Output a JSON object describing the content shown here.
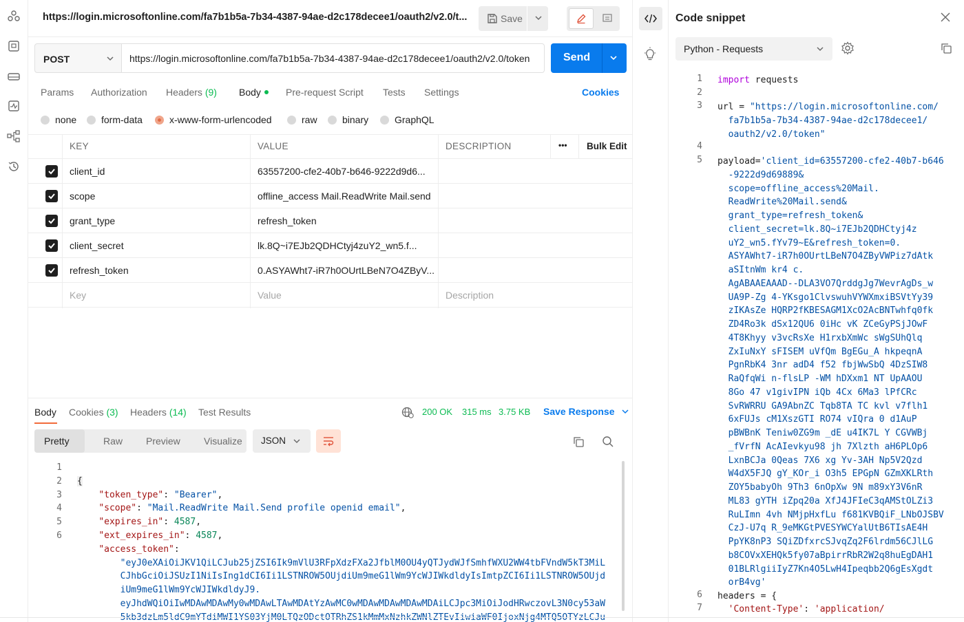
{
  "request": {
    "title": "https://login.microsoftonline.com/fa7b1b5a-7b34-4387-94ae-d2c178decee1/oauth2/v2.0/t...",
    "save_label": "Save",
    "method": "POST",
    "url": "https://login.microsoftonline.com/fa7b1b5a-7b34-4387-94ae-d2c178decee1/oauth2/v2.0/token",
    "send_label": "Send"
  },
  "tabs": {
    "params": "Params",
    "authorization": "Authorization",
    "headers": "Headers",
    "headers_count": "(9)",
    "body": "Body",
    "pre_request": "Pre-request Script",
    "tests": "Tests",
    "settings": "Settings",
    "cookies": "Cookies"
  },
  "body_types": {
    "none": "none",
    "form_data": "form-data",
    "urlencoded": "x-www-form-urlencoded",
    "raw": "raw",
    "binary": "binary",
    "graphql": "GraphQL"
  },
  "table": {
    "headers": {
      "key": "KEY",
      "value": "VALUE",
      "description": "DESCRIPTION",
      "more": "•••",
      "bulk_edit": "Bulk Edit"
    },
    "rows": [
      {
        "key": "client_id",
        "value": "63557200-cfe2-40b7-b646-9222d9d6..."
      },
      {
        "key": "scope",
        "value": "offline_access Mail.ReadWrite Mail.send"
      },
      {
        "key": "grant_type",
        "value": "refresh_token"
      },
      {
        "key": "client_secret",
        "value": "lk.8Q~i7EJb2QDHCtyj4zuY2_wn5.f..."
      },
      {
        "key": "refresh_token",
        "value": "0.ASYAWht7-iR7h0OUrtLBeN7O4ZByV..."
      }
    ],
    "placeholder": {
      "key": "Key",
      "value": "Value",
      "description": "Description"
    }
  },
  "response": {
    "tabs": {
      "body": "Body",
      "cookies": "Cookies",
      "cookies_count": "(3)",
      "headers": "Headers",
      "headers_count": "(14)",
      "test_results": "Test Results"
    },
    "status": "200 OK",
    "time": "315 ms",
    "size": "3.75 KB",
    "save_response": "Save Response",
    "views": {
      "pretty": "Pretty",
      "raw": "Raw",
      "preview": "Preview",
      "visualize": "Visualize"
    },
    "format": "JSON",
    "lines": {
      "l1": "{",
      "token_type_key": "\"token_type\"",
      "token_type_val": "\"Bearer\"",
      "scope_key": "\"scope\"",
      "scope_val": "\"Mail.ReadWrite Mail.Send profile openid email\"",
      "expires_key": "\"expires_in\"",
      "expires_val": "4587",
      "ext_expires_key": "\"ext_expires_in\"",
      "ext_expires_val": "4587",
      "access_key": "\"access_token\"",
      "token_line1": "\"eyJ0eXAiOiJKV1QiLCJub25jZSI6Ik9mVlU3RFpXdzFXa2JfblM0OU4yQTJydWJfSmhfWXU2WW4tbFVndW5kT3MiL",
      "token_line2": "CJhbGciOiJSUzI1NiIsIng1dCI6Ii1LSTNROW5OUjdiUm9meG1lWm9YcWJIWkdldyIsImtpZCI6Ii1LSTNROW5OUjd",
      "token_line3": "iUm9meG1lWm9YcWJIWkdldyJ9.",
      "token_line4": "eyJhdWQiOiIwMDAwMDAwMy0wMDAwLTAwMDAtYzAwMC0wMDAwMDAwMDAwMDAiLCJpc3MiOiJodHRwczovL3N0cy53aW",
      "token_line5": "5kb3dzLm5ldC9mYTdiMWI1YS03YjM0LTQzODctOTRhZS1kMmMxNzhkZWNlZTEvIiwiaWF0IjoxNjg4MTQ5OTYzLCJu"
    }
  },
  "snippet": {
    "title": "Code snippet",
    "language": "Python - Requests",
    "code": {
      "l1_kw": "import",
      "l1_rest": " requests",
      "l3_var": "url = ",
      "l3_str_a": "\"https://login.microsoftonline.com/",
      "l3_str_b": "  fa7b1b5a-7b34-4387-94ae-d2c178decee1/",
      "l3_str_c": "  oauth2/v2.0/token\"",
      "l5_var": "payload=",
      "p1": "'client_id=63557200-cfe2-40b7-b646",
      "p2": "  -9222d9d69889&",
      "p3": "  scope=offline_access%20Mail.",
      "p4": "  ReadWrite%20Mail.send&",
      "p5": "  grant_type=refresh_token&",
      "p6": "  client_secret=lk.8Q~i7EJb2QDHCtyj4z",
      "p7": "  uY2_wn5.fYv79~E&refresh_token=0.",
      "p8": "  ASYAWht7-iR7h0OUrtLBeN7O4ZByVWPiz7dAtk",
      "p9": "  aSItnWm kr4 c.",
      "p10": "  AgABAAEAAAD--DLA3VO7QrddgJg7WevrAgDs_w",
      "p11": "  UA9P-Zg 4-YKsgo1ClvswuhVYWXmxiBSVtYy39",
      "p12": "  zIKAsZe HQRP2fKBESAGM1XcO2AcBNTwhfq0fk",
      "p13": "  ZD4Ro3k dSx12QU6 0iHc vK ZCeGyPSjJOwF",
      "p14": "  4T8Khyy v3vcRsXe H1rxbXmWc sWgSUhQlq",
      "p15": "  ZxIuNxY sFISEM uVfQm BgEGu_A hkpeqnA",
      "p16": "  PgnRbK4 3nr adD4 f52 fbjWwSbQ 4DzSIW8",
      "p17": "  RaQfqWi n-flsLP -WM hDXxm1 NT UpAAOU",
      "p18": "  8Go 47 v1givIPN iQb 4Cx 6Ma3 lPfCRc",
      "p19": "  SvRWRRU GA9AbnZC Tqb8TA TC kvl v7flh1",
      "p20": "  6xFUJs cM1XszGTI RO74 vIQra 0 d1AuP",
      "p21": "  pBWBnK Teniw0ZG9m _dE u4IK7L Y CGVWBj",
      "p22": "  _fVrfN AcAIevkyu98 jh 7Xlzth aH6PLOp6",
      "p23": "  LxnBCJa 0Qeas 7X6 xg Yv-3AH Np5V2Qzd",
      "p24": "  W4dX5FJQ gY_KOr_i O3h5 EPGpN GZmXKLRth",
      "p25": "  ZOY5babyOh 9Th3 6nOpXw 9N m89xY3V6nR",
      "p26": "  ML83 gYTH iZpq20a XfJ4JFIeC3qAMStOLZi3",
      "p27": "  RuLImn 4vh NMjpHxfLu f681KVBQiF_LNbOJSBV",
      "p28": "  CzJ-U7q R_9eMKGtPVESYWCYalUtB6TIsAE4H",
      "p29": "  PpYK8nP3 SQiZDfxrcSJvqZq2F6lrdm56CJlLG",
      "p30": "  b8COVxXEHQk5fy07aBpirrRbR2W2q8huEgDAH1",
      "p31": "  01BLRlgiiIyZ7Kn4O5LwH4Ipeqbb2Q6gEsXgdt",
      "p32": "  orB4vg'",
      "l6_var": "headers = {",
      "l7_key": "  'Content-Type'",
      "l7_colon": ": ",
      "l7_val": "'application/"
    }
  },
  "colors": {
    "accent": "#097bed",
    "status_ok": "#0cbb52",
    "body_tab_underline": "#f26b3a"
  }
}
